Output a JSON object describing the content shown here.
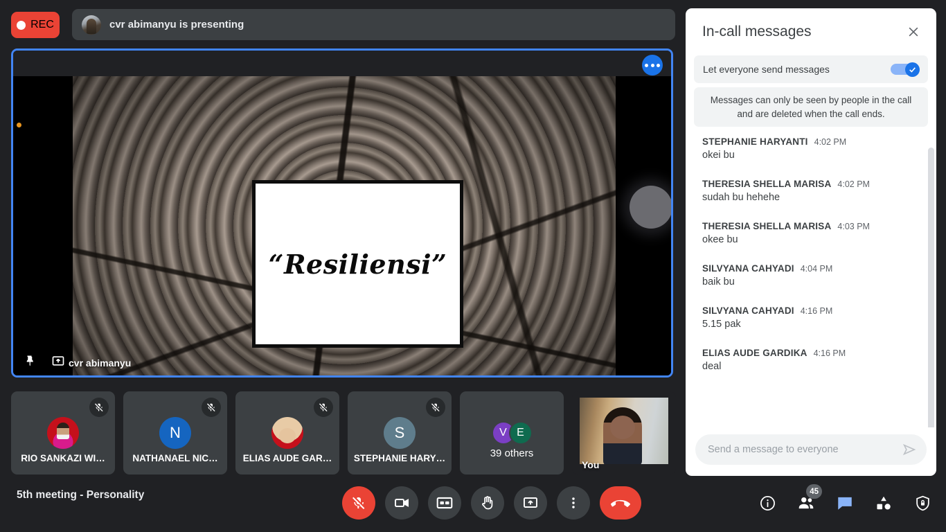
{
  "recording": {
    "label": "REC"
  },
  "presenting_banner": {
    "text": "cvr abimanyu is presenting",
    "avatar": "presenter-photo"
  },
  "stage": {
    "presenter_name": "cvr abimanyu",
    "slide_text": "“Resiliensi”",
    "more_options": "more-options",
    "pin": "pin-icon",
    "present_to_all": "present-icon"
  },
  "thumbnails": [
    {
      "name": "RIO SANKAZI WI…",
      "type": "photo",
      "muted": true
    },
    {
      "name": "NATHANAEL NIC…",
      "type": "initial",
      "initial": "N",
      "color": "#1565c0",
      "muted": true
    },
    {
      "name": "ELIAS AUDE GAR…",
      "type": "photo",
      "muted": true
    },
    {
      "name": "STEPHANIE HARY…",
      "type": "initial",
      "initial": "S",
      "color": "#5f7d8c",
      "muted": true
    }
  ],
  "others_tile": {
    "count_label": "39 others",
    "avatars": [
      {
        "initial": "V",
        "color": "#7B3FC4"
      },
      {
        "initial": "E",
        "color": "#0F6B4F"
      }
    ]
  },
  "self_tile": {
    "label": "You",
    "muted": true
  },
  "chat": {
    "title": "In-call messages",
    "close": "close-icon",
    "toggle_label": "Let everyone send messages",
    "toggle_on": true,
    "notice": "Messages can only be seen by people in the call and are deleted when the call ends.",
    "messages": [
      {
        "author": "STEPHANIE HARYANTI",
        "time": "4:02 PM",
        "text": "okei bu"
      },
      {
        "author": "THERESIA SHELLA MARISA",
        "time": "4:02 PM",
        "text": "sudah bu hehehe"
      },
      {
        "author": "THERESIA SHELLA MARISA",
        "time": "4:03 PM",
        "text": "okee bu"
      },
      {
        "author": "SILVYANA CAHYADI",
        "time": "4:04 PM",
        "text": "baik bu"
      },
      {
        "author": "SILVYANA CAHYADI",
        "time": "4:16 PM",
        "text": "5.15 pak"
      },
      {
        "author": "ELIAS AUDE GARDIKA",
        "time": "4:16 PM",
        "text": "deal"
      }
    ],
    "input_placeholder": "Send a message to everyone",
    "send": "send-icon"
  },
  "bottom": {
    "meeting_title": "5th meeting - Personality",
    "controls": [
      {
        "name": "microphone-off-button"
      },
      {
        "name": "camera-button"
      },
      {
        "name": "captions-button"
      },
      {
        "name": "raise-hand-button"
      },
      {
        "name": "present-now-button"
      },
      {
        "name": "more-options-button"
      },
      {
        "name": "end-call-button"
      }
    ],
    "right_controls": {
      "info": "meeting-details-icon",
      "people": "people-icon",
      "people_count": "45",
      "chat": "chat-icon",
      "activities": "activities-icon",
      "host_controls": "host-controls-icon"
    }
  },
  "colors": {
    "accent_blue": "#1a73e8",
    "tile_border": "#4285f4",
    "record_red": "#ea4335",
    "chat_active": "#8ab4f8",
    "panel_bg": "#ffffff",
    "app_bg": "#202124"
  }
}
